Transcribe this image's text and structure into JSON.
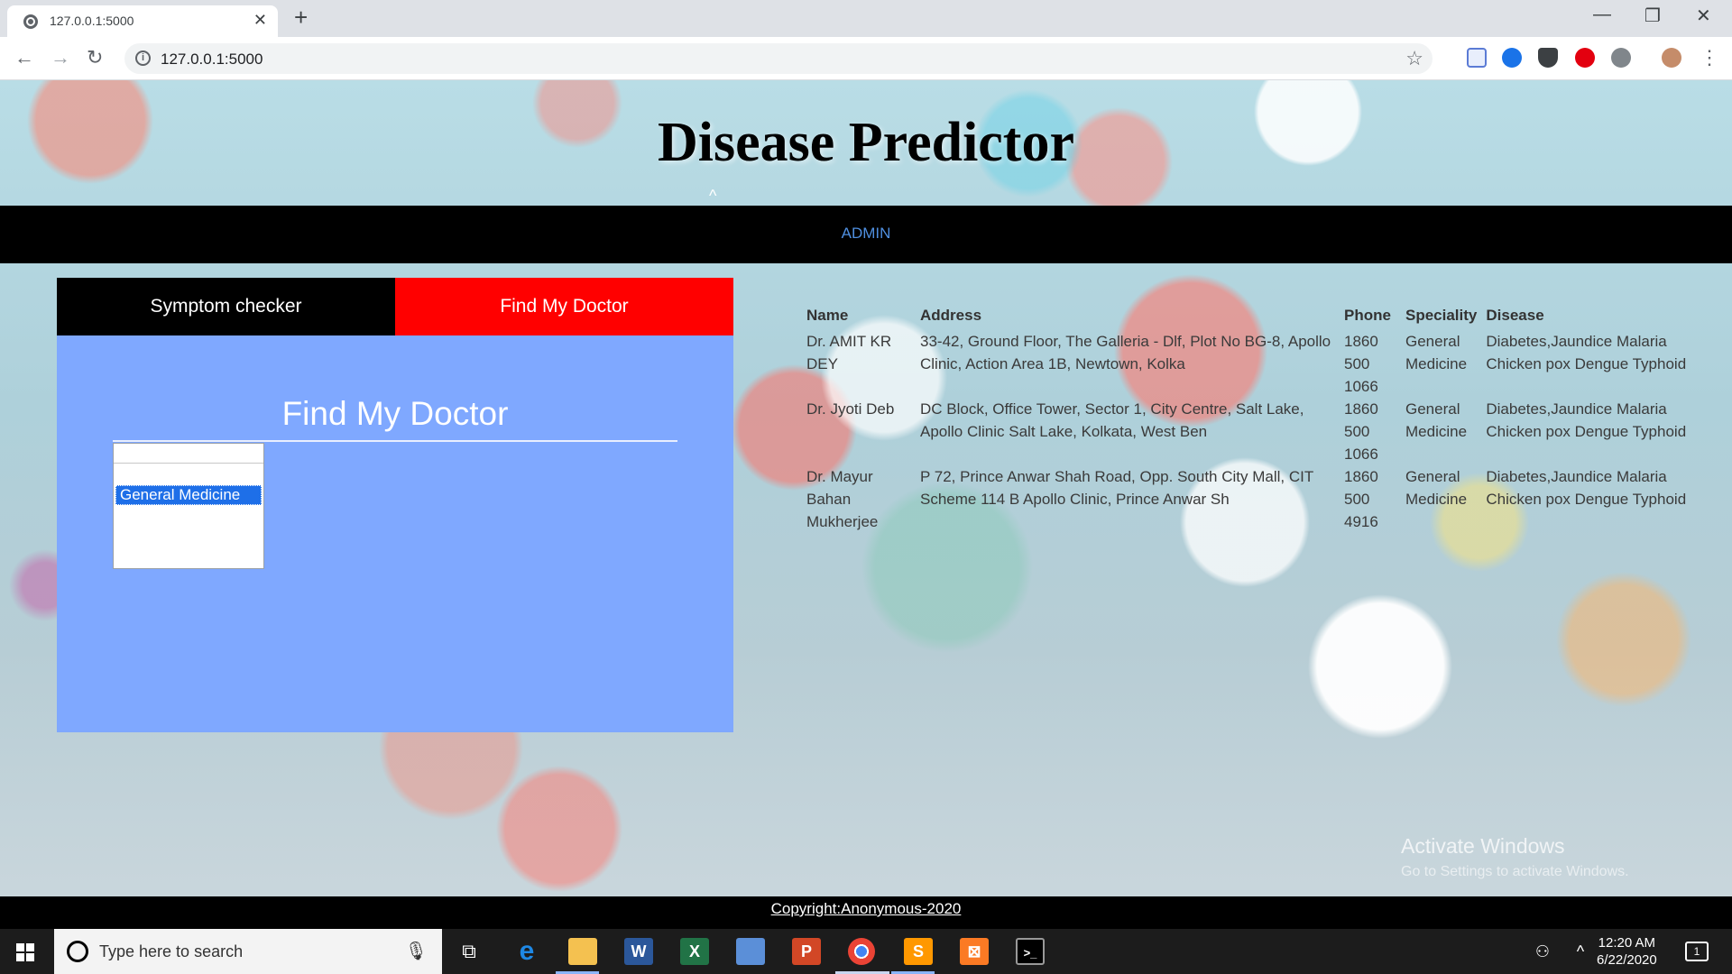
{
  "browser": {
    "tab_title": "127.0.0.1:5000",
    "new_tab": "+",
    "close_tab": "✕",
    "url": "127.0.0.1:5000",
    "window_controls": {
      "minimize": "—",
      "maximize": "❐",
      "close": "✕"
    },
    "nav": {
      "back": "←",
      "forward": "→",
      "reload": "↻"
    },
    "bookmark": "☆",
    "info_icon": "i",
    "menu": "⋮"
  },
  "site": {
    "title": "Disease Predictor",
    "caret": "^",
    "nav": {
      "admin": "ADMIN"
    }
  },
  "panel": {
    "tabs": {
      "symptom_checker": "Symptom checker",
      "find_doctor": "Find My Doctor"
    },
    "heading": "Find My Doctor",
    "specialty_select": {
      "selected": "General Medicine"
    }
  },
  "doctors": {
    "headers": {
      "name": "Name",
      "address": "Address",
      "phone": "Phone",
      "speciality": "Speciality",
      "disease": "Disease"
    },
    "rows": [
      {
        "name": "Dr. AMIT KR DEY",
        "address": "33-42, Ground Floor, The Galleria - Dlf, Plot No BG-8, Apollo Clinic, Action Area 1B, Newtown, Kolka",
        "phone": "1860 500 1066",
        "speciality": "General Medicine",
        "disease": "Diabetes,Jaundice Malaria Chicken pox Dengue Typhoid"
      },
      {
        "name": "Dr. Jyoti Deb",
        "address": "DC Block, Office Tower, Sector 1, City Centre, Salt Lake, Apollo Clinic Salt Lake, Kolkata, West Ben",
        "phone": "1860 500 1066",
        "speciality": "General Medicine",
        "disease": "Diabetes,Jaundice Malaria Chicken pox Dengue Typhoid"
      },
      {
        "name": "Dr. Mayur Bahan Mukherjee",
        "address": "P 72, Prince Anwar Shah Road, Opp. South City Mall, CIT Scheme 114 B Apollo Clinic, Prince Anwar Sh",
        "phone": "1860 500 4916",
        "speciality": "General Medicine",
        "disease": "Diabetes,Jaundice Malaria Chicken pox Dengue Typhoid"
      }
    ]
  },
  "watermark": {
    "line1": "Activate Windows",
    "line2": "Go to Settings to activate Windows."
  },
  "footer": {
    "copyright": "Copyright:Anonymous-2020"
  },
  "taskbar": {
    "search_placeholder": "Type here to search",
    "mic_icon": "🎙",
    "task_view": "⧉",
    "apps": {
      "edge": "e",
      "word": "W",
      "excel": "X",
      "powerpoint": "P",
      "sublime": "S",
      "xampp": "⊠",
      "terminal": ">_"
    },
    "tray": {
      "people": "⚇",
      "chevron": "^",
      "time": "12:20 AM",
      "date": "6/22/2020",
      "notifications": "1"
    }
  },
  "colors": {
    "admin_link": "#4f8fe0",
    "panel_bg": "#7fa8ff",
    "active_tab": "#ff0000",
    "inactive_tab": "#000000",
    "navbar": "#000000"
  }
}
